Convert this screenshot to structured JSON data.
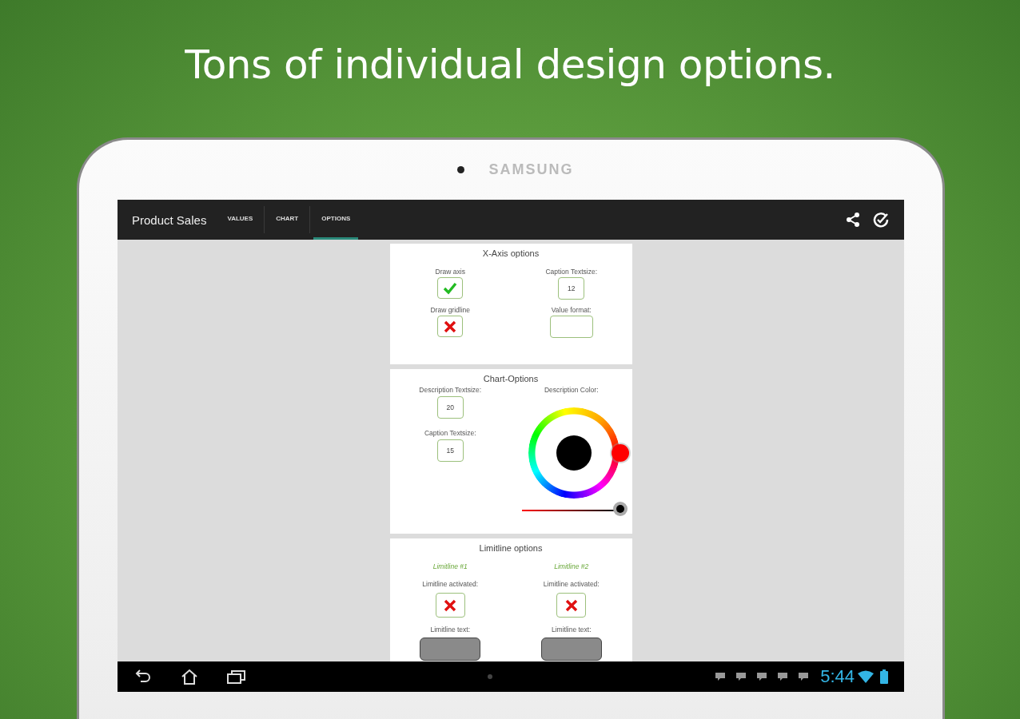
{
  "headline": "Tons of individual design options.",
  "device": {
    "brand": "SAMSUNG"
  },
  "app_bar": {
    "title": "Product Sales",
    "tabs": [
      {
        "label": "VALUES",
        "selected": false
      },
      {
        "label": "CHART",
        "selected": false
      },
      {
        "label": "OPTIONS",
        "selected": true
      }
    ]
  },
  "x_axis_options": {
    "title": "X-Axis options",
    "fields": [
      {
        "kind": "checkbox",
        "label": "Draw axis",
        "checked": true
      },
      {
        "kind": "number",
        "label": "Caption Textsize:",
        "value": "12"
      },
      {
        "kind": "checkbox",
        "label": "Draw gridline",
        "checked": false
      },
      {
        "kind": "text",
        "label": "Value format:"
      }
    ]
  },
  "chart_options": {
    "title": "Chart-Options",
    "description_textsize": {
      "label": "Description Textsize:",
      "value": "20"
    },
    "caption_textsize": {
      "label": "Caption Textsize:",
      "value": "15"
    },
    "description_color": {
      "label": "Description Color:"
    },
    "brightness": {
      "level": 1
    }
  },
  "limitline_options": {
    "title": "Limitline options",
    "limitlines": [
      {
        "name": "Limitline #1",
        "activated_label": "Limitline activated:",
        "activated": false,
        "text_label": "Limitline text:"
      },
      {
        "name": "Limitline #2",
        "activated_label": "Limitline activated:",
        "activated": false,
        "text_label": "Limitline text:"
      }
    ]
  },
  "status_bar": {
    "time": "5:44"
  }
}
